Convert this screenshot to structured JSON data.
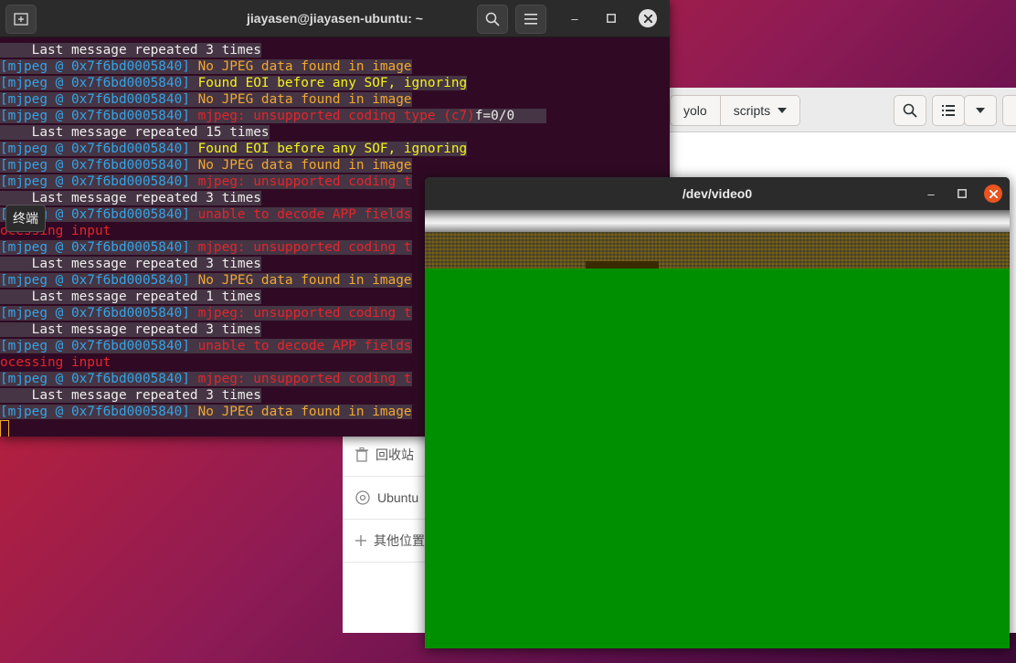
{
  "file_manager": {
    "path_segments": [
      "yolo",
      "scripts"
    ],
    "sidebar": [
      {
        "icon": "trash-icon",
        "label": "回收站"
      },
      {
        "icon": "disc-icon",
        "label": "Ubuntu"
      },
      {
        "icon": "plus-icon",
        "label": "其他位置"
      }
    ]
  },
  "terminal": {
    "title": "jiayasen@jiayasen-ubuntu: ~",
    "tooltip": "终端",
    "lines": [
      [
        {
          "t": "    Last message repeated 3 times",
          "c": "info",
          "bg": true
        }
      ],
      [
        {
          "t": "[mjpeg @ 0x7f6bd0005840] ",
          "c": "blue",
          "bg": true
        },
        {
          "t": "No JPEG data found in image",
          "c": "orange",
          "bg": true
        }
      ],
      [
        {
          "t": "[mjpeg @ 0x7f6bd0005840] ",
          "c": "blue",
          "bg": true
        },
        {
          "t": "Found EOI before any SOF, ignoring",
          "c": "yellow",
          "bg": true
        }
      ],
      [
        {
          "t": "[mjpeg @ 0x7f6bd0005840] ",
          "c": "blue",
          "bg": true
        },
        {
          "t": "No JPEG data found in image",
          "c": "orange",
          "bg": true
        }
      ],
      [
        {
          "t": "[mjpeg @ 0x7f6bd0005840] ",
          "c": "blue",
          "bg": true
        },
        {
          "t": "mjpeg: unsupported coding type (c7)",
          "c": "red",
          "bg": true
        },
        {
          "t": "f=0/0    ",
          "c": "info",
          "bg": true
        }
      ],
      [
        {
          "t": "    Last message repeated 15 times",
          "c": "info",
          "bg": true
        }
      ],
      [
        {
          "t": "[mjpeg @ 0x7f6bd0005840] ",
          "c": "blue",
          "bg": true
        },
        {
          "t": "Found EOI before any SOF, ignoring",
          "c": "yellow",
          "bg": true
        }
      ],
      [
        {
          "t": "[mjpeg @ 0x7f6bd0005840] ",
          "c": "blue",
          "bg": true
        },
        {
          "t": "No JPEG data found in image",
          "c": "orange",
          "bg": true
        }
      ],
      [
        {
          "t": "[mjpeg @ 0x7f6bd0005840] ",
          "c": "blue",
          "bg": true
        },
        {
          "t": "mjpeg: unsupported coding t",
          "c": "red",
          "bg": true
        }
      ],
      [
        {
          "t": "    Last message repeated 3 times",
          "c": "info",
          "bg": true
        }
      ],
      [
        {
          "t": "[mjpeg @ 0x7f6bd0005840] ",
          "c": "blue",
          "bg": true
        },
        {
          "t": "unable to decode APP fields",
          "c": "red",
          "bg": true
        }
      ],
      [
        {
          "t": "ocessing input",
          "c": "red",
          "bg": false
        }
      ],
      [
        {
          "t": "[mjpeg @ 0x7f6bd0005840] ",
          "c": "blue",
          "bg": true
        },
        {
          "t": "mjpeg: unsupported coding t",
          "c": "red",
          "bg": true
        }
      ],
      [
        {
          "t": "    Last message repeated 3 times",
          "c": "info",
          "bg": true
        }
      ],
      [
        {
          "t": "[mjpeg @ 0x7f6bd0005840] ",
          "c": "blue",
          "bg": true
        },
        {
          "t": "No JPEG data found in image",
          "c": "orange",
          "bg": true
        }
      ],
      [
        {
          "t": "    Last message repeated 1 times",
          "c": "info",
          "bg": true
        }
      ],
      [
        {
          "t": "[mjpeg @ 0x7f6bd0005840] ",
          "c": "blue",
          "bg": true
        },
        {
          "t": "mjpeg: unsupported coding t",
          "c": "red",
          "bg": true
        }
      ],
      [
        {
          "t": "    Last message repeated 3 times",
          "c": "info",
          "bg": true
        }
      ],
      [
        {
          "t": "[mjpeg @ 0x7f6bd0005840] ",
          "c": "blue",
          "bg": true
        },
        {
          "t": "unable to decode APP fields",
          "c": "red",
          "bg": true
        }
      ],
      [
        {
          "t": "ocessing input",
          "c": "red",
          "bg": false
        }
      ],
      [
        {
          "t": "[mjpeg @ 0x7f6bd0005840] ",
          "c": "blue",
          "bg": true
        },
        {
          "t": "mjpeg: unsupported coding t",
          "c": "red",
          "bg": true
        }
      ],
      [
        {
          "t": "    Last message repeated 3 times",
          "c": "info",
          "bg": true
        }
      ],
      [
        {
          "t": "[mjpeg @ 0x7f6bd0005840] ",
          "c": "blue",
          "bg": true
        },
        {
          "t": "No JPEG data found in image",
          "c": "orange",
          "bg": true
        }
      ]
    ]
  },
  "video_window": {
    "title": "/dev/video0"
  },
  "colors": {
    "terminal_bg": "#300a24",
    "prefix_blue": "#34a4e6",
    "warn_orange": "#f0a830",
    "warn_yellow": "#f5f21a",
    "error_red": "#e5242b",
    "video_green": "#008f00",
    "close_orange": "#e95420"
  }
}
